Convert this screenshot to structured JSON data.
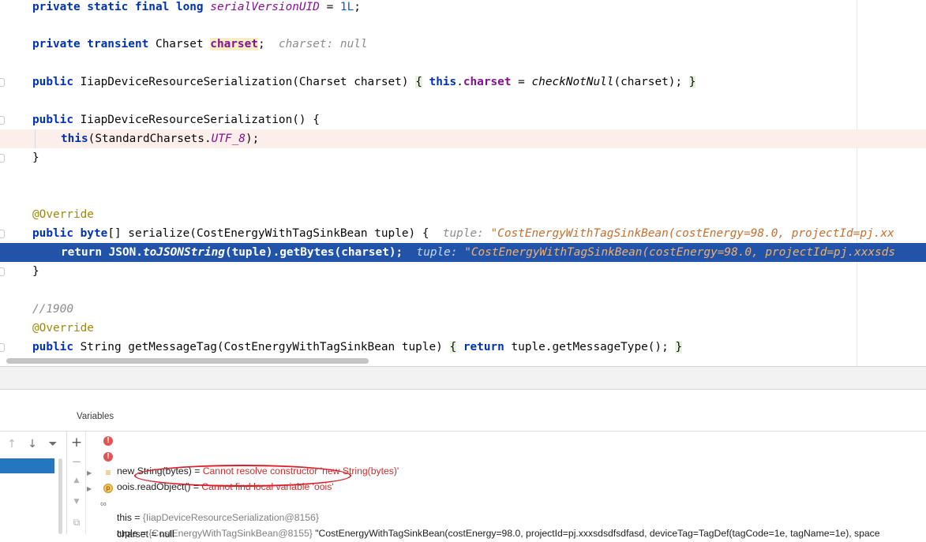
{
  "editor": {
    "lines": {
      "l1": {
        "kw": "private static final long",
        "const": "serialVersionUID",
        "eq": " = ",
        "num": "1L",
        "end": ";"
      },
      "l2": {
        "kw": "private transient",
        "type": " Charset ",
        "name": "charset",
        "end": ";",
        "hint": "charset: null"
      },
      "l3": {
        "kw": "public",
        "sig": " IiapDeviceResourceSerialization(Charset charset) ",
        "lb": "{",
        "sp": " ",
        "this": "this",
        "dot": ".",
        "field": "charset",
        "eq": " = ",
        "call": "checkNotNull",
        "args": "(charset); ",
        "rb": "}"
      },
      "l4": {
        "kw": "public",
        "sig": " IiapDeviceResourceSerialization() {"
      },
      "l5": {
        "kw": "this",
        "open": "(StandardCharsets.",
        "const": "UTF_8",
        "close": ");"
      },
      "l6": {
        "text": "}"
      },
      "l7": {
        "text": "@Override"
      },
      "l8": {
        "kw": "public byte",
        "sig": "[] serialize(CostEnergyWithTagSinkBean tuple) {",
        "hint_label": "tuple: ",
        "hint_value": "\"CostEnergyWithTagSinkBean(costEnergy=98.0, projectId=pj.xx"
      },
      "l9": {
        "kw": "return",
        "a": " JSON.",
        "call": "toJSONString",
        "b": "(tuple).getBytes(charset);",
        "hint_label": "tuple: ",
        "hint_value": "\"CostEnergyWithTagSinkBean(costEnergy=98.0, projectId=pj.xxxsds"
      },
      "l10": {
        "text": "}"
      },
      "l11": {
        "text": "//1900"
      },
      "l12": {
        "text": "@Override"
      },
      "l13": {
        "kw": "public",
        "sig": " String getMessageTag(CostEnergyWithTagSinkBean tuple) ",
        "lb": "{",
        "sp": " ",
        "kw2": "return",
        "rest": " tuple.getMessageType(); ",
        "rb": "}"
      }
    }
  },
  "debugger": {
    "variables_title": "Variables",
    "toolbar": {
      "up": "↑",
      "down": "↓",
      "filter": "⏷",
      "add": "+",
      "remove": "−",
      "move_up": "▲",
      "move_down": "▼",
      "copy": "⧉"
    },
    "variables": [
      {
        "expr": "new String(bytes) = ",
        "value": "Cannot resolve constructor 'new String(bytes)'"
      },
      {
        "expr": "oois.readObject() = ",
        "value": "Cannot find local variable 'oois'"
      },
      {
        "expr": "this = ",
        "value": "{IiapDeviceResourceSerialization@8156}"
      },
      {
        "expr": "tuple = ",
        "ref": "{CostEnergyWithTagSinkBean@8155} ",
        "value": "\"CostEnergyWithTagSinkBean(costEnergy=98.0, projectId=pj.xxxsdsdfsdfasd, deviceTag=TagDef(tagCode=1e, tagName=1e), space"
      },
      {
        "expr": "charset = null"
      }
    ]
  }
}
